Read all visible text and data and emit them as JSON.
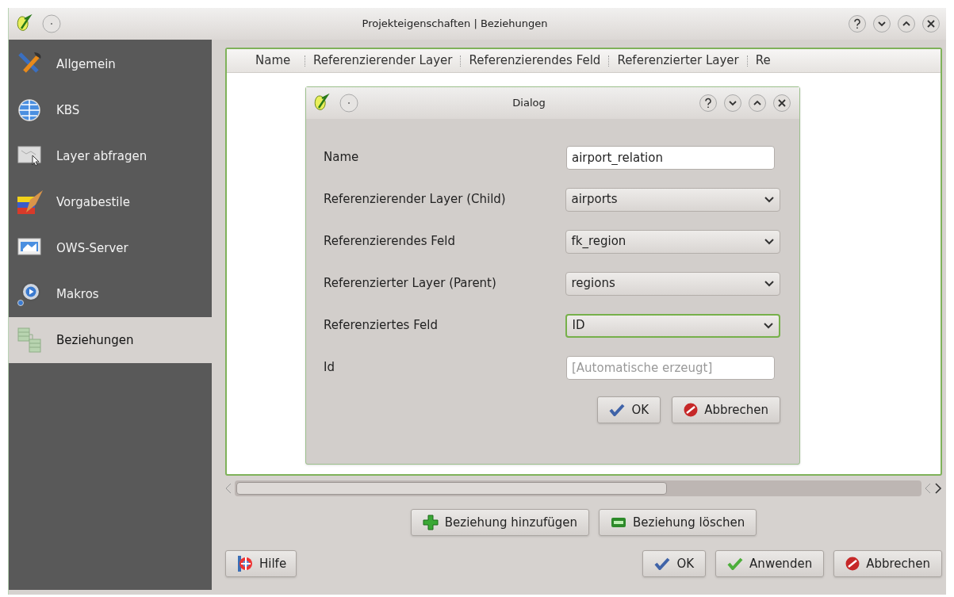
{
  "window": {
    "title": "Projekteigenschaften | Beziehungen"
  },
  "sidebar": {
    "items": [
      {
        "label": "Allgemein",
        "selected": false
      },
      {
        "label": "KBS",
        "selected": false
      },
      {
        "label": "Layer abfragen",
        "selected": false
      },
      {
        "label": "Vorgabestile",
        "selected": false
      },
      {
        "label": "OWS-Server",
        "selected": false
      },
      {
        "label": "Makros",
        "selected": false
      },
      {
        "label": "Beziehungen",
        "selected": true
      }
    ]
  },
  "table": {
    "columns": [
      "Name",
      "Referenzierender Layer",
      "Referenzierendes Feld",
      "Referenzierter Layer",
      "Re"
    ]
  },
  "relation_buttons": [
    {
      "kind": "add",
      "label": "Beziehung hinzufügen"
    },
    {
      "kind": "remove",
      "label": "Beziehung löschen"
    }
  ],
  "footer": {
    "help": {
      "kind": "help",
      "label": "Hilfe"
    },
    "buttons": [
      {
        "kind": "ok",
        "label": "OK"
      },
      {
        "kind": "apply",
        "label": "Anwenden"
      },
      {
        "kind": "cancel",
        "label": "Abbrechen"
      }
    ]
  },
  "dialog": {
    "title": "Dialog",
    "fields": [
      {
        "kind": "text",
        "label": "Name",
        "value": "airport_relation",
        "focused": false
      },
      {
        "kind": "select",
        "label": "Referenzierender Layer (Child)",
        "value": "airports",
        "focused": false
      },
      {
        "kind": "select",
        "label": "Referenzierendes Feld",
        "value": "fk_region",
        "focused": false
      },
      {
        "kind": "select",
        "label": "Referenzierter Layer (Parent)",
        "value": "regions",
        "focused": false
      },
      {
        "kind": "select",
        "label": "Referenziertes Feld",
        "value": "ID",
        "focused": true
      },
      {
        "kind": "text",
        "label": "Id",
        "placeholder": "[Automatische erzeugt]",
        "focused": false
      }
    ],
    "buttons": [
      {
        "kind": "ok",
        "label": "OK"
      },
      {
        "kind": "cancel",
        "label": "Abbrechen"
      }
    ]
  }
}
